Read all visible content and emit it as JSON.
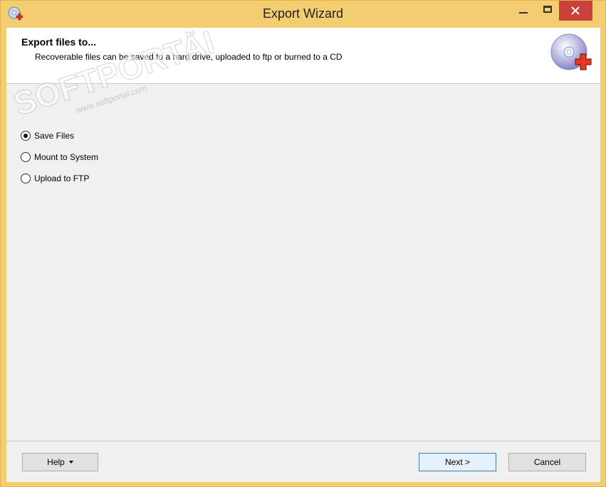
{
  "window": {
    "title": "Export Wizard"
  },
  "header": {
    "title": "Export files to...",
    "subtitle": "Recoverable files can be saved to a hard drive, uploaded to ftp or burned to a CD"
  },
  "options": [
    {
      "label": "Save Files",
      "checked": true
    },
    {
      "label": "Mount to System",
      "checked": false
    },
    {
      "label": "Upload to FTP",
      "checked": false
    }
  ],
  "footer": {
    "help_label": "Help",
    "next_label": "Next >",
    "cancel_label": "Cancel"
  },
  "watermark": {
    "text": "SOFTPORTAL",
    "url": "www.softportal.com",
    "mark": "TM"
  },
  "colors": {
    "frame": "#f4cd70",
    "close": "#c8413a",
    "client": "#f0f0f0",
    "default_button_border": "#3c7fb1"
  }
}
